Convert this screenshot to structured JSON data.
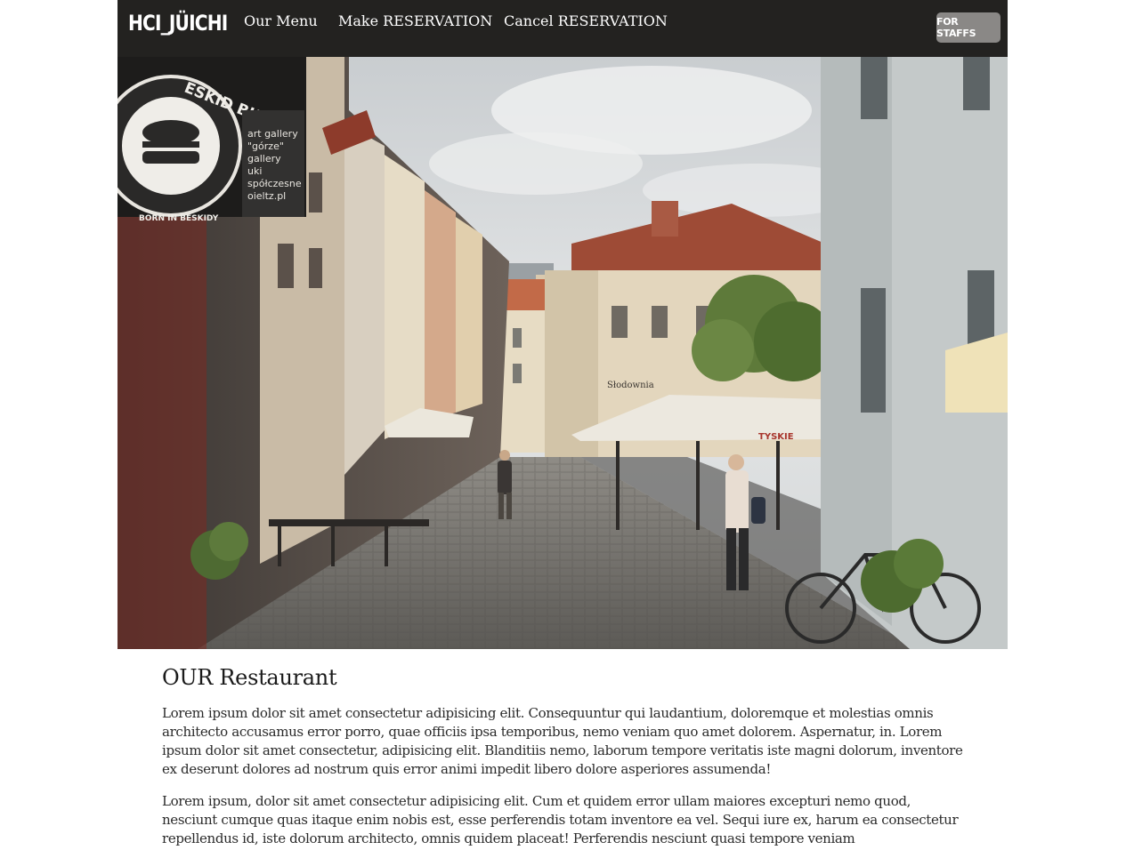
{
  "navbar": {
    "brand": "HCI_JÜICHI",
    "links": [
      "Our Menu",
      "Make RESERVATION",
      "Cancel RESERVATION"
    ],
    "staff_button": "FOR STAFFS",
    "background": "#232220"
  },
  "hero": {
    "sign_title": "ESKID BURGER",
    "sign_subtitle": "BORN IN BESKIDY",
    "gallery_sign": "art gallery\n\"górze\"\ngallery\nuki\nspółczesne\noieltz.pl",
    "shop_sign": "Słodownia",
    "umbrella_text": "TYSKIE"
  },
  "content": {
    "title": "OUR Restaurant",
    "paragraphs": [
      "Lorem ipsum dolor sit amet consectetur adipisicing elit. Consequuntur qui laudantium, doloremque et molestias omnis architecto accusamus error porro, quae officiis ipsa temporibus, nemo veniam quo amet dolorem. Aspernatur, in. Lorem ipsum dolor sit amet consectetur, adipisicing elit. Blanditiis nemo, laborum tempore veritatis iste magni dolorum, inventore ex deserunt dolores ad nostrum quis error animi impedit libero dolore asperiores assumenda!",
      "Lorem ipsum, dolor sit amet consectetur adipisicing elit. Cum et quidem error ullam maiores excepturi nemo quod, nesciunt cumque quas itaque enim nobis est, esse perferendis totam inventore ea vel. Sequi iure ex, harum ea consectetur repellendus id, iste dolorum architecto, omnis quidem placeat! Perferendis nesciunt quasi tempore veniam"
    ]
  }
}
